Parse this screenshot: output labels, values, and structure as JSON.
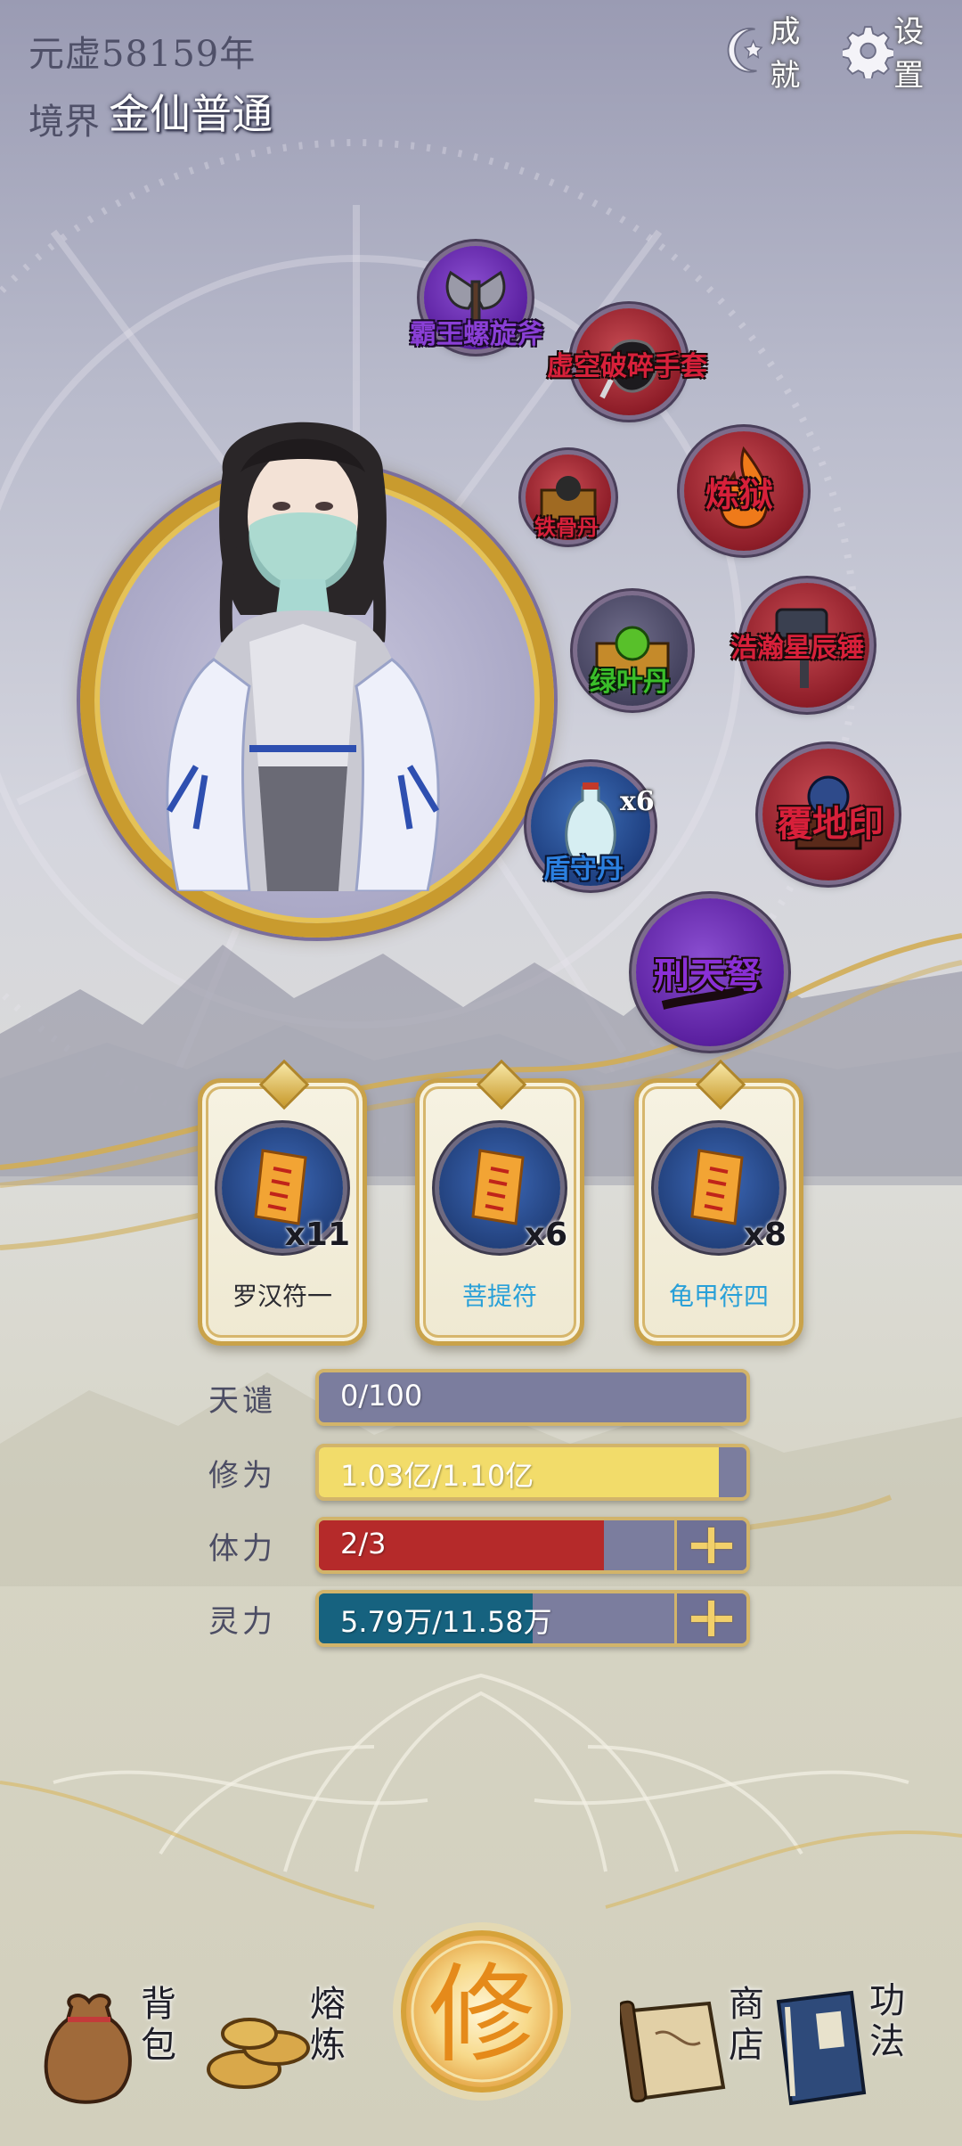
{
  "header": {
    "era": "元虚58159年",
    "realm_label": "境界",
    "realm_value": "金仙普通",
    "achievements_label": "成就",
    "settings_label": "设置"
  },
  "equipment": [
    {
      "name": "霸王螺旋斧",
      "color": "purple"
    },
    {
      "name": "虚空破碎手套",
      "color": "red"
    },
    {
      "name": "铁骨丹",
      "color": "red"
    },
    {
      "name": "炼狱",
      "color": "red"
    },
    {
      "name": "绿叶丹",
      "color": "green"
    },
    {
      "name": "浩瀚星辰锤",
      "color": "red"
    },
    {
      "name": "盾守丹",
      "color": "blue",
      "count": "x6"
    },
    {
      "name": "覆地印",
      "color": "red"
    },
    {
      "name": "刑天弩",
      "color": "purple"
    }
  ],
  "talismans": [
    {
      "name": "罗汉符一",
      "count": "x11",
      "color": "#2a2a30"
    },
    {
      "name": "菩提符",
      "count": "x6",
      "color": "#29a0d8"
    },
    {
      "name": "龟甲符四",
      "count": "x8",
      "color": "#29a0d8"
    }
  ],
  "stats": {
    "tianqian": {
      "label": "天谴",
      "text": "0/100",
      "fill": 0.0,
      "color": "#7b7d9e"
    },
    "xiuwei": {
      "label": "修为",
      "text": "1.03亿/1.10亿",
      "fill": 0.936,
      "color": "#f2dc6a"
    },
    "tili": {
      "label": "体力",
      "text": "2/3",
      "fill": 0.667,
      "color": "#b52a2a"
    },
    "lingli": {
      "label": "灵力",
      "text": "5.79万/11.58万",
      "fill": 0.5,
      "color": "#16627f"
    }
  },
  "nav": {
    "bag": "背包",
    "smelt": "熔炼",
    "cultivate": "修",
    "shop": "商店",
    "skills": "功法"
  }
}
